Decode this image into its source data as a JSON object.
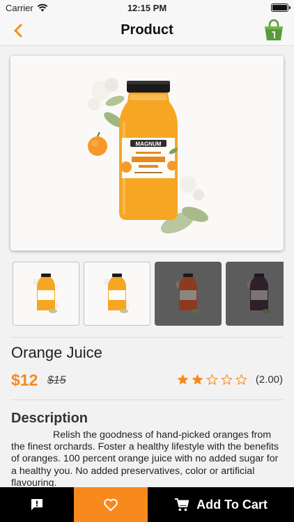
{
  "status_bar": {
    "carrier": "Carrier",
    "time": "12:15 PM"
  },
  "nav": {
    "title": "Product",
    "back_icon": "chevron-left-icon",
    "cart_icon": "shopping-bag-icon"
  },
  "gallery": {
    "main_image": "orange-juice-bottle",
    "bottle_brand": "MAGNUM",
    "thumbnails": [
      {
        "image": "orange-juice-bottle",
        "selected": true
      },
      {
        "image": "orange-juice-bottle",
        "selected": false
      },
      {
        "image": "red-juice-bottle",
        "selected": false
      },
      {
        "image": "dark-juice-bottle",
        "selected": false
      }
    ]
  },
  "product": {
    "name": "Orange Juice",
    "price": "$12",
    "old_price": "$15",
    "rating": 2,
    "rating_max": 5,
    "rating_label": "(2.00)"
  },
  "description": {
    "title": "Description",
    "body": "Relish the goodness of hand-picked oranges from the finest orchards. Foster a healthy lifestyle with the benefits of oranges. 100 percent orange juice with no added sugar for a healthy you. No added preservatives, color or artificial flavouring."
  },
  "bottom_bar": {
    "feedback_icon": "feedback-icon",
    "wishlist_icon": "heart-icon",
    "cart_icon": "cart-icon",
    "add_to_cart_label": "Add To Cart"
  },
  "colors": {
    "accent": "#f7891d",
    "bag": "#5a9a3a",
    "bottom_bar": "#000000"
  }
}
